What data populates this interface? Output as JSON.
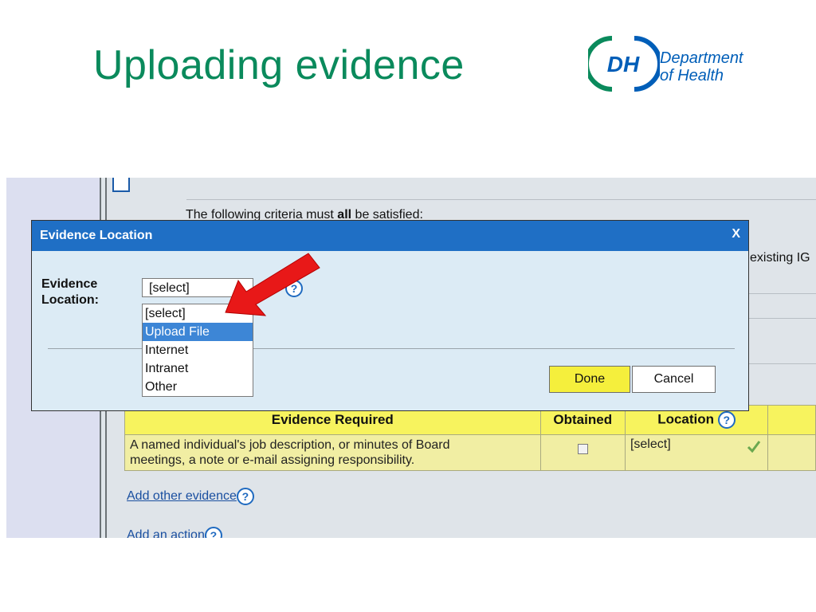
{
  "slide": {
    "title": "Uploading evidence",
    "logo": {
      "mark": "DH",
      "line1": "Department",
      "line2": "of Health"
    }
  },
  "background": {
    "criteria_prefix": "The following criteria must ",
    "criteria_bold": "all",
    "criteria_suffix": " be satisfied:",
    "right_fragment": "existing IG"
  },
  "dialog": {
    "title": "Evidence Location",
    "close_label": "X",
    "field_label_line1": "Evidence",
    "field_label_line2": "Location:",
    "selected_value": "[select]",
    "options": [
      "[select]",
      "Upload File",
      "Internet",
      "Intranet",
      "Other"
    ],
    "highlighted_option": "Upload File",
    "done_label": "Done",
    "cancel_label": "Cancel"
  },
  "table": {
    "headers": [
      "Evidence Required",
      "Obtained",
      "Location"
    ],
    "rows": [
      {
        "evidence_line1": "A named individual's job description, or minutes of Board",
        "evidence_line2": "meetings, a note or e-mail assigning responsibility.",
        "obtained": false,
        "location": "[select]"
      }
    ]
  },
  "links": {
    "add_evidence": "Add other evidence",
    "add_action": "Add an action"
  },
  "colors": {
    "title_green": "#0a8a5c",
    "dh_blue": "#005eb8",
    "dialog_titlebar": "#1f6fc5",
    "done_yellow": "#f5ef3c",
    "table_header": "#f7f35e",
    "arrow_red": "#e81818"
  },
  "icons": [
    "help-icon",
    "check-icon",
    "red-arrow-icon"
  ]
}
